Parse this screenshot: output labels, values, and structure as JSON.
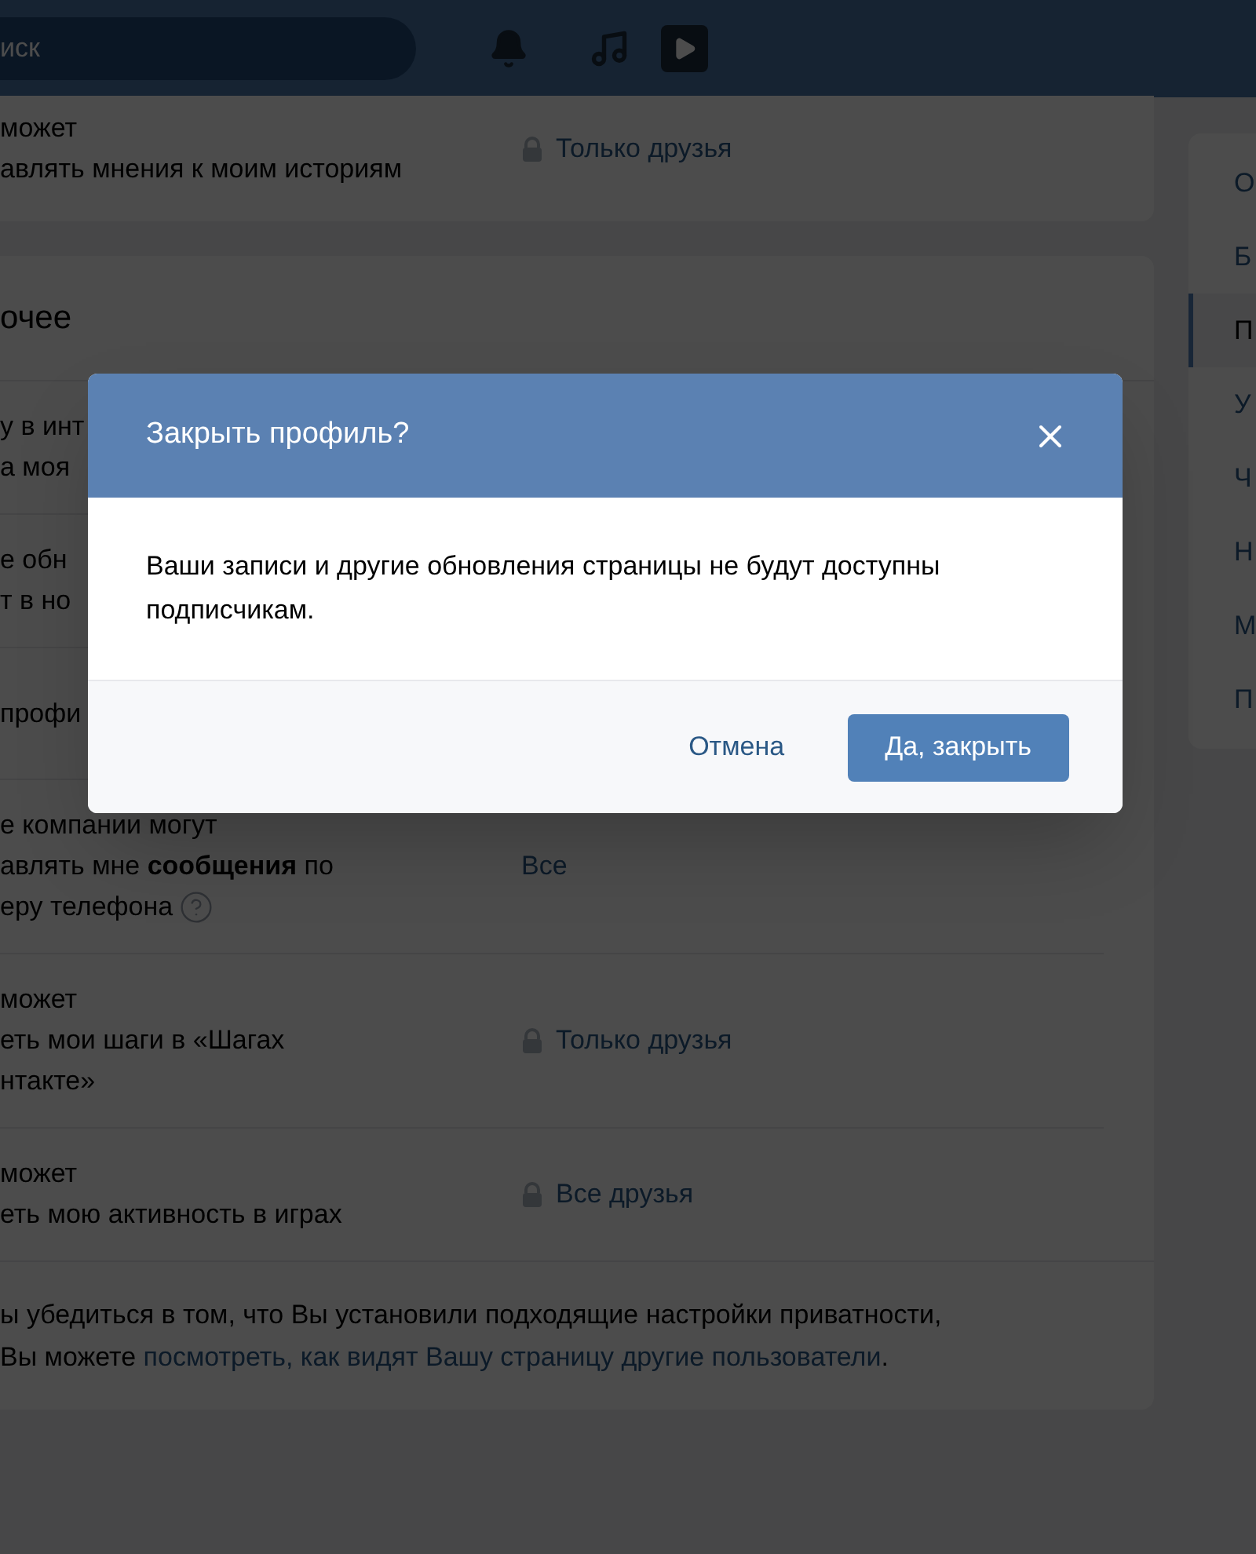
{
  "header": {
    "search": {
      "placeholder": "иск"
    }
  },
  "top_card": {
    "rows": [
      {
        "label_lines": [
          "может",
          "авлять мнения к моим историям"
        ],
        "value": "Только друзья",
        "locked": true,
        "help": false
      }
    ]
  },
  "section": {
    "title": "очее",
    "rows": [
      {
        "label_lines": [
          "у в инт",
          "а моя"
        ]
      },
      {
        "label_lines": [
          "е обн",
          "т в но"
        ]
      },
      {
        "label_lines": [
          "профи"
        ]
      },
      {
        "label_lines": [
          "е компании могут",
          "авлять мне **сообщения** по",
          "еру телефона"
        ],
        "value": "Все",
        "locked": false,
        "help": true
      },
      {
        "label_lines": [
          "может",
          "еть мои шаги в «Шагах",
          "нтакте»"
        ],
        "value": "Только друзья",
        "locked": true,
        "help": false
      },
      {
        "label_lines": [
          "может",
          "еть мою активность в играх"
        ],
        "value": "Все друзья",
        "locked": true,
        "help": false
      }
    ],
    "note": {
      "line_1": "ы убедиться в том, что Вы установили подходящие настройки приватности,",
      "line_2": "Вы можете ",
      "link": "посмотреть, как видят Вашу страницу другие пользователи",
      "end": "."
    }
  },
  "sidebar": {
    "items": [
      {
        "label": "О",
        "selected": false
      },
      {
        "label": "Б",
        "selected": false
      },
      {
        "label": "П",
        "selected": true
      },
      {
        "label": "У",
        "selected": false
      },
      {
        "label": "Ч",
        "selected": false
      },
      {
        "label": "Н",
        "selected": false
      },
      {
        "label": "М",
        "selected": false
      },
      {
        "label": "П",
        "selected": false
      }
    ]
  },
  "dialog": {
    "title": "Закрыть профиль?",
    "body": "Ваши записи и другие обновления страницы не будут доступны подписчикам.",
    "buttons": [
      {
        "label": "Отмена",
        "kind": "secondary"
      },
      {
        "label": "Да, закрыть",
        "kind": "primary"
      }
    ]
  }
}
